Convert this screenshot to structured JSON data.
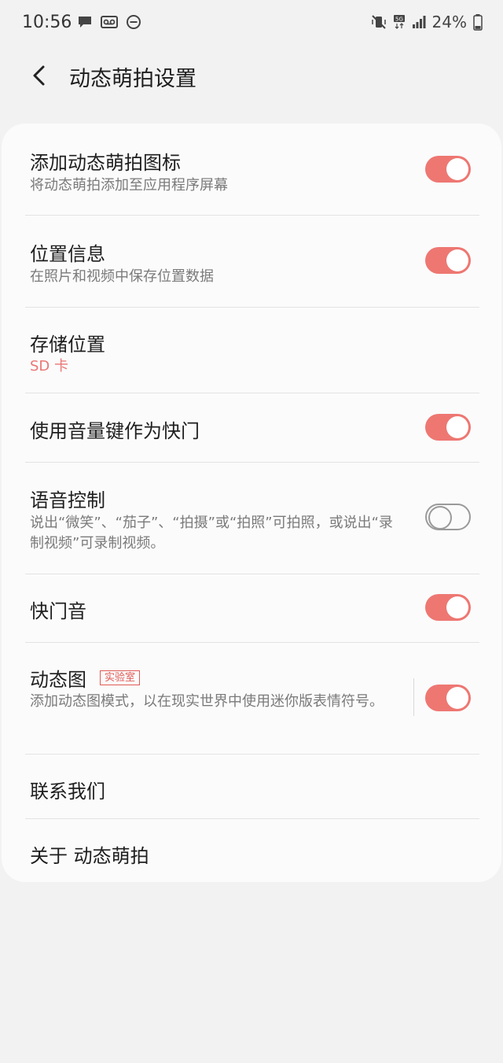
{
  "status_bar": {
    "time": "10:56",
    "battery_percent": "24%",
    "icons_left": [
      "message-icon",
      "voicemail-icon",
      "do-not-disturb-icon"
    ],
    "icons_right": [
      "vibrate-mute-icon",
      "5g-icon",
      "signal-icon",
      "battery-icon"
    ]
  },
  "header": {
    "title": "动态萌拍设置",
    "back_icon": "back-arrow-icon"
  },
  "settings": [
    {
      "title": "添加动态萌拍图标",
      "subtitle": "将动态萌拍添加至应用程序屏幕",
      "toggle": true
    },
    {
      "title": "位置信息",
      "subtitle": "在照片和视频中保存位置数据",
      "toggle": true
    },
    {
      "title": "存储位置",
      "subtitle": "SD 卡"
    },
    {
      "title": "使用音量键作为快门",
      "toggle": true
    },
    {
      "title": "语音控制",
      "subtitle": "说出“微笑”、“茄子”、“拍摄”或“拍照”可拍照，或说出“录制视频”可录制视频。",
      "toggle": false
    },
    {
      "title": "快门音",
      "toggle": true
    },
    {
      "title": "动态图",
      "badge": "实验室",
      "subtitle": "添加动态图模式，以在现实世界中使用迷你版表情符号。",
      "toggle": true
    },
    {
      "title": "联系我们"
    },
    {
      "title": "关于 动态萌拍"
    }
  ],
  "colors": {
    "accent": "#ee7772",
    "background": "#f2f2f2",
    "card": "#fbfbfb"
  }
}
